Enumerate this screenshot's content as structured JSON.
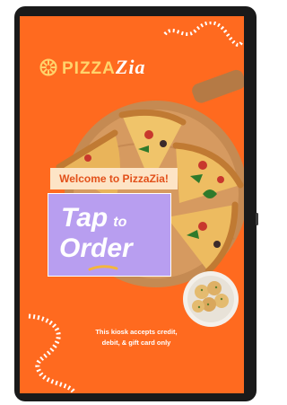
{
  "kiosk": {
    "brand": {
      "logo_icon": "pizza-slice-icon",
      "name_part1": "PIZZA",
      "name_part2": "Zia"
    },
    "welcome_text": "Welcome to PizzaZia!",
    "cta": {
      "line1_word": "Tap",
      "line1_small": "to",
      "line2_word": "Order"
    },
    "notice_line1": "This kiosk accepts credit,",
    "notice_line2": "debit, & gift card only"
  },
  "colors": {
    "background": "#ff6a1f",
    "logo_accent": "#ffd36b",
    "welcome_bg": "#fde4c6",
    "welcome_text": "#e2501a",
    "cta_bg": "#b89ef0",
    "underline": "#f4b63c"
  }
}
